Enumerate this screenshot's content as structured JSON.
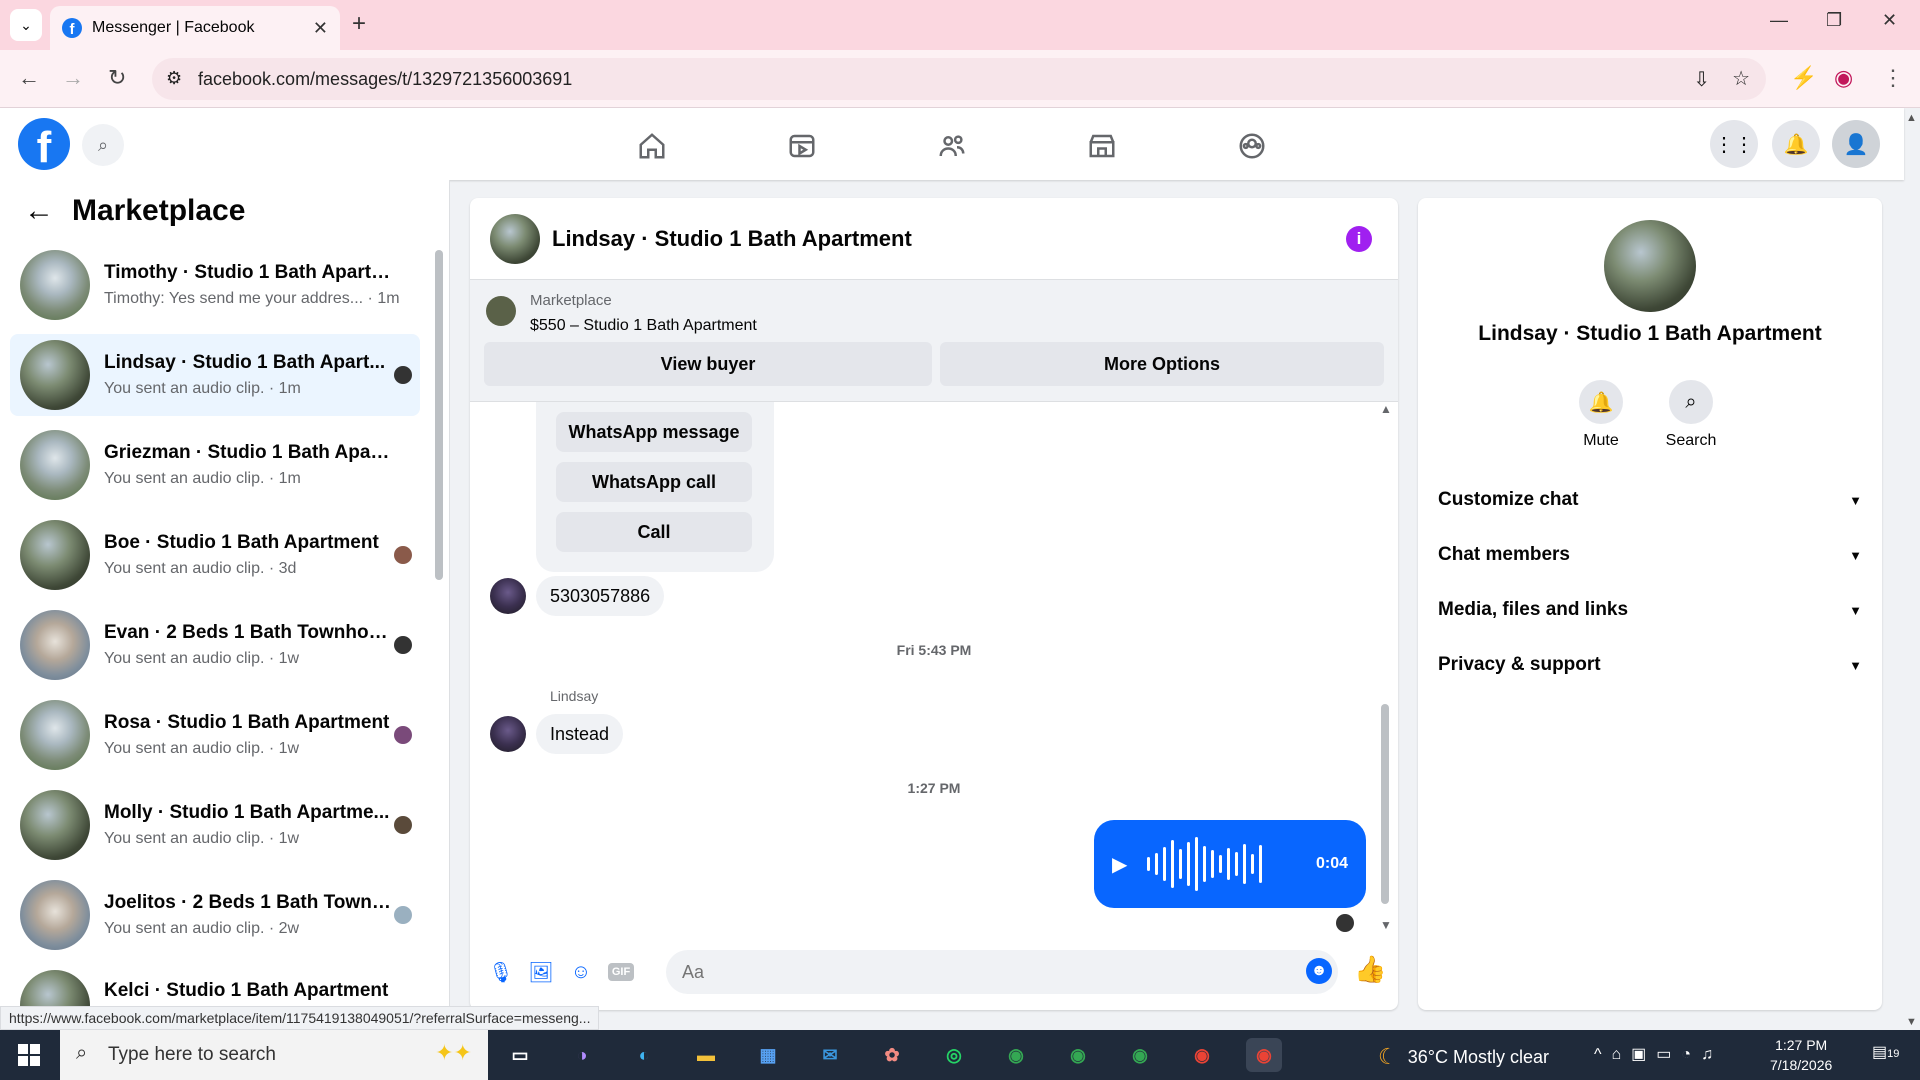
{
  "browser": {
    "tab_title": "Messenger | Facebook",
    "url": "facebook.com/messages/t/1329721356003691",
    "status_url": "https://www.facebook.com/marketplace/item/1175419138049051/?referralSurface=messeng..."
  },
  "fb": {
    "logo_letter": "f"
  },
  "left": {
    "title": "Marketplace",
    "conversations": [
      {
        "name": "Timothy · Studio 1 Bath Apartm...",
        "preview": "Timothy: Yes send me your addres... · 1m"
      },
      {
        "name": "Lindsay · Studio 1 Bath Apart...",
        "preview": "You sent an audio clip. · 1m"
      },
      {
        "name": "Griezman · Studio 1 Bath Apart...",
        "preview": "You sent an audio clip. · 1m"
      },
      {
        "name": "Boe · Studio 1 Bath Apartment",
        "preview": "You sent an audio clip. · 3d"
      },
      {
        "name": "Evan · 2 Beds 1 Bath Townhouse",
        "preview": "You sent an audio clip. · 1w"
      },
      {
        "name": "Rosa · Studio 1 Bath Apartment",
        "preview": "You sent an audio clip. · 1w"
      },
      {
        "name": "Molly · Studio 1 Bath Apartme...",
        "preview": "You sent an audio clip. · 1w"
      },
      {
        "name": "Joelitos · 2 Beds 1 Bath Townh...",
        "preview": "You sent an audio clip. · 2w"
      },
      {
        "name": "Kelci · Studio 1 Bath Apartment",
        "preview": ""
      }
    ]
  },
  "chat": {
    "title": "Lindsay · Studio 1 Bath Apartment",
    "listing_label": "Marketplace",
    "listing": "$550 – Studio 1 Bath Apartment",
    "view_buyer": "View buyer",
    "more_options": "More Options",
    "opt_whatsapp_message": "WhatsApp message",
    "opt_whatsapp_call": "WhatsApp call",
    "opt_call": "Call",
    "msg_phone": "5303057886",
    "stamp1": "Fri 5:43 PM",
    "sender": "Lindsay",
    "msg_instead": "Instead",
    "stamp2": "1:27 PM",
    "audio_duration": "0:04",
    "input_placeholder": "Aa"
  },
  "info": {
    "name": "Lindsay · Studio 1 Bath Apartment",
    "mute": "Mute",
    "search": "Search",
    "sections": [
      "Customize chat",
      "Chat members",
      "Media, files and links",
      "Privacy & support"
    ]
  },
  "taskbar": {
    "search_placeholder": "Type here to search",
    "weather": "36°C  Mostly clear",
    "time": "1:27 PM",
    "date": "7/18/2026",
    "notif_count": "19"
  },
  "colors": {
    "accent": "#0866ff",
    "fb_blue": "#1877f2",
    "info_purple": "#a020f0",
    "tab_bg": "#fbd7e0"
  }
}
